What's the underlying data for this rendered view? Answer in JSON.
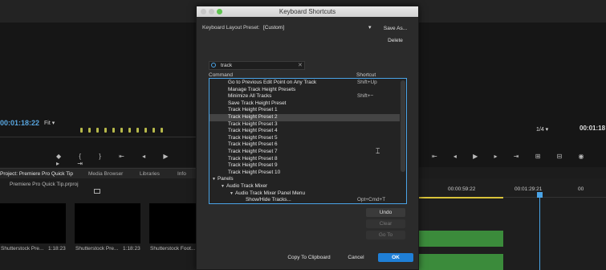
{
  "background": {
    "program_timecode": "00:01:18:22",
    "fit": "Fit",
    "zoom_ratio": "1/4",
    "source_timecode": "00:01:18",
    "project_tab": "Project: Premiere Pro Quick Tip",
    "media_browser_tab": "Media Browser",
    "libraries_tab": "Libraries",
    "info_tab": "Info",
    "project_file": "Premiere Pro Quick Tip.prproj",
    "thumbnails": [
      {
        "label": "Shutterstock Pre...",
        "duration": "1:18:23"
      },
      {
        "label": "Shutterstock Pre...",
        "duration": "1:18:23"
      },
      {
        "label": "Shutterstock Foot...",
        "duration": ""
      }
    ],
    "timeline_ticks": [
      "00:00:59:22",
      "00:01:29:21",
      "00"
    ],
    "accent_color": "#4aa3e6"
  },
  "dialog": {
    "title": "Keyboard Shortcuts",
    "preset_label": "Keyboard Layout Preset:",
    "preset_value": "[Custom]",
    "save_as": "Save As...",
    "delete": "Delete",
    "search_value": "track",
    "col_command": "Command",
    "col_shortcut": "Shortcut",
    "rows": [
      {
        "cmd": "Go to Previous Edit Point on Any Track",
        "sc": "Shift+Up"
      },
      {
        "cmd": "Manage Track Height Presets",
        "sc": ""
      },
      {
        "cmd": "Minimize All Tracks",
        "sc": "Shift+−"
      },
      {
        "cmd": "Save Track Height Preset",
        "sc": ""
      },
      {
        "cmd": "Track Height Preset 1",
        "sc": ""
      },
      {
        "cmd": "Track Height Preset 2",
        "sc": ""
      },
      {
        "cmd": "Track Height Preset 3",
        "sc": ""
      },
      {
        "cmd": "Track Height Preset 4",
        "sc": ""
      },
      {
        "cmd": "Track Height Preset 5",
        "sc": ""
      },
      {
        "cmd": "Track Height Preset 6",
        "sc": ""
      },
      {
        "cmd": "Track Height Preset 7",
        "sc": ""
      },
      {
        "cmd": "Track Height Preset 8",
        "sc": ""
      },
      {
        "cmd": "Track Height Preset 9",
        "sc": ""
      },
      {
        "cmd": "Track Height Preset 10",
        "sc": ""
      },
      {
        "cmd": "Panels",
        "sc": ""
      },
      {
        "cmd": "Audio Track Mixer",
        "sc": ""
      },
      {
        "cmd": "Audio Track Mixer Panel Menu",
        "sc": ""
      },
      {
        "cmd": "Show/Hide Tracks...",
        "sc": "Opt+Cmd+T"
      }
    ],
    "undo": "Undo",
    "clear": "Clear",
    "go_to": "Go To",
    "copy_to_clipboard": "Copy To Clipboard",
    "cancel": "Cancel",
    "ok": "OK"
  }
}
